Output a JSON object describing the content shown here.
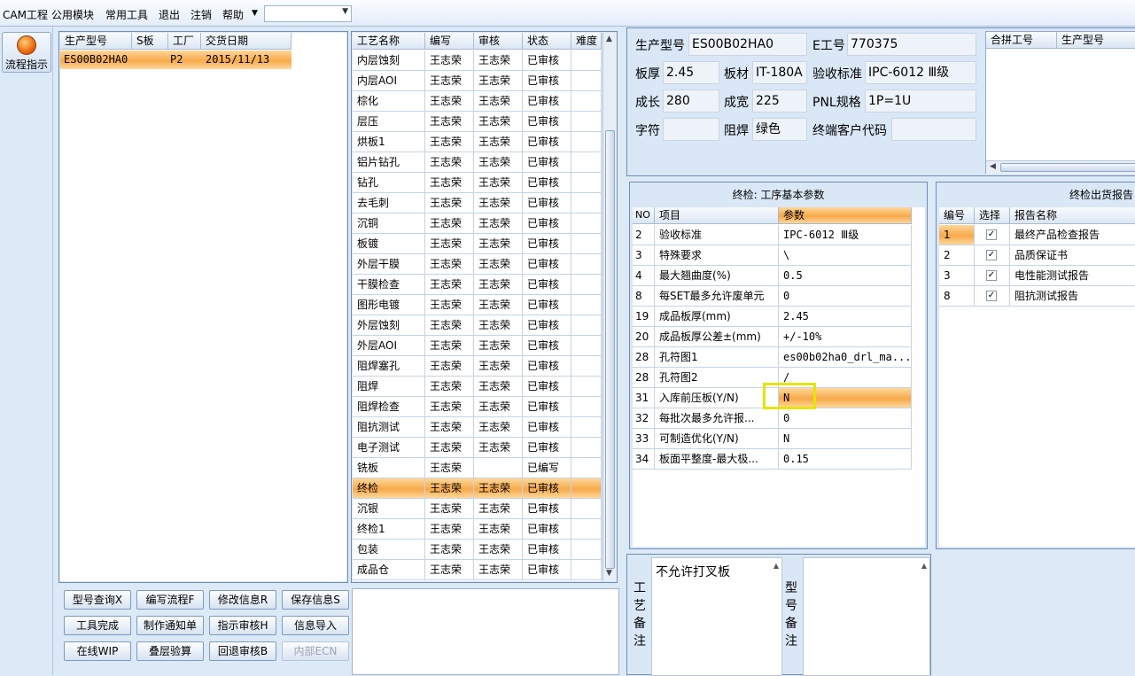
{
  "menu": {
    "items": [
      "CAM工程",
      "公用模块",
      "常用工具",
      "退出",
      "注销",
      "帮助"
    ],
    "dropdown_value": ""
  },
  "nav": {
    "flow_label": "流程指示"
  },
  "orders": {
    "headers": [
      "生产型号",
      "S板",
      "工厂",
      "交货日期"
    ],
    "rows": [
      {
        "model": "ES00B02HA0",
        "s": "",
        "factory": "P2",
        "date": "2015/11/13"
      }
    ]
  },
  "process": {
    "headers": [
      "工艺名称",
      "编写",
      "审核",
      "状态",
      "难度"
    ],
    "rows": [
      [
        "内层蚀刻",
        "王志荣",
        "王志荣",
        "已审核"
      ],
      [
        "内层AOI",
        "王志荣",
        "王志荣",
        "已审核"
      ],
      [
        "棕化",
        "王志荣",
        "王志荣",
        "已审核"
      ],
      [
        "层压",
        "王志荣",
        "王志荣",
        "已审核"
      ],
      [
        "烘板1",
        "王志荣",
        "王志荣",
        "已审核"
      ],
      [
        "铝片钻孔",
        "王志荣",
        "王志荣",
        "已审核"
      ],
      [
        "钻孔",
        "王志荣",
        "王志荣",
        "已审核"
      ],
      [
        "去毛刺",
        "王志荣",
        "王志荣",
        "已审核"
      ],
      [
        "沉铜",
        "王志荣",
        "王志荣",
        "已审核"
      ],
      [
        "板镀",
        "王志荣",
        "王志荣",
        "已审核"
      ],
      [
        "外层干膜",
        "王志荣",
        "王志荣",
        "已审核"
      ],
      [
        "干膜检查",
        "王志荣",
        "王志荣",
        "已审核"
      ],
      [
        "图形电镀",
        "王志荣",
        "王志荣",
        "已审核"
      ],
      [
        "外层蚀刻",
        "王志荣",
        "王志荣",
        "已审核"
      ],
      [
        "外层AOI",
        "王志荣",
        "王志荣",
        "已审核"
      ],
      [
        "阻焊塞孔",
        "王志荣",
        "王志荣",
        "已审核"
      ],
      [
        "阻焊",
        "王志荣",
        "王志荣",
        "已审核"
      ],
      [
        "阻焊检查",
        "王志荣",
        "王志荣",
        "已审核"
      ],
      [
        "阻抗测试",
        "王志荣",
        "王志荣",
        "已审核"
      ],
      [
        "电子测试",
        "王志荣",
        "王志荣",
        "已审核"
      ],
      [
        "铣板",
        "王志荣",
        "",
        "已编写"
      ],
      [
        "终检",
        "王志荣",
        "王志荣",
        "已审核"
      ],
      [
        "沉银",
        "王志荣",
        "王志荣",
        "已审核"
      ],
      [
        "终检1",
        "王志荣",
        "王志荣",
        "已审核"
      ],
      [
        "包装",
        "王志荣",
        "王志荣",
        "已审核"
      ],
      [
        "成品仓",
        "王志荣",
        "王志荣",
        "已审核"
      ]
    ]
  },
  "buttons": [
    [
      "型号查询X",
      "编写流程F",
      "修改信息R",
      "保存信息S"
    ],
    [
      "工具完成",
      "制作通知单",
      "指示审核H",
      "信息导入"
    ],
    [
      "在线WIP",
      "叠层验算",
      "回退审核B",
      "内部ECN"
    ]
  ],
  "info": {
    "model_label": "生产型号",
    "model_value": "ES00B02HA0",
    "e_label": "E工号",
    "e_value": "770375",
    "thick_label": "板厚",
    "thick_value": "2.45",
    "material_label": "板材",
    "material_value": "IT-180A",
    "standard_label": "验收标准",
    "standard_value": "IPC-6012 Ⅲ级",
    "length_label": "成长",
    "length_value": "280",
    "width_label": "成宽",
    "width_value": "225",
    "pnl_label": "PNL规格",
    "pnl_value": "1P=1U",
    "char_label": "字符",
    "char_value": "",
    "mask_label": "阻焊",
    "mask_value": "绿色",
    "cust_label": "终端客户代码",
    "cust_value": ""
  },
  "merge": {
    "headers": [
      "合拼工号",
      "生产型号"
    ]
  },
  "params": {
    "title": "终检: 工序基本参数",
    "headers": [
      "NO",
      "项目",
      "参数"
    ],
    "rows": [
      [
        "2",
        "验收标准",
        "IPC-6012 Ⅲ级"
      ],
      [
        "3",
        "特殊要求",
        "\\"
      ],
      [
        "4",
        "最大翘曲度(%)",
        "0.5"
      ],
      [
        "8",
        "每SET最多允许废单元",
        "0"
      ],
      [
        "19",
        "成品板厚(mm)",
        "2.45"
      ],
      [
        "20",
        "成品板厚公差±(mm)",
        "+/-10%"
      ],
      [
        "28",
        "孔符图1",
        "es00b02ha0_drl_ma..."
      ],
      [
        "28",
        "孔符图2",
        "/"
      ],
      [
        "31",
        "入库前压板(Y/N)",
        "N"
      ],
      [
        "32",
        "每批次最多允许报...",
        "0"
      ],
      [
        "33",
        "可制造优化(Y/N)",
        "N"
      ],
      [
        "34",
        "板面平整度-最大极...",
        "0.15"
      ]
    ]
  },
  "reports": {
    "title": "终检出货报告",
    "headers": [
      "编号",
      "选择",
      "报告名称"
    ],
    "rows": [
      [
        "1",
        "✓",
        "最终产品检查报告"
      ],
      [
        "2",
        "✓",
        "品质保证书"
      ],
      [
        "3",
        "✓",
        "电性能测试报告"
      ],
      [
        "8",
        "✓",
        "阻抗测试报告"
      ]
    ]
  },
  "notes": {
    "craft_label": "工艺备注",
    "craft_text": "不允许打叉板",
    "model_label": "型号备注",
    "model_text": ""
  }
}
